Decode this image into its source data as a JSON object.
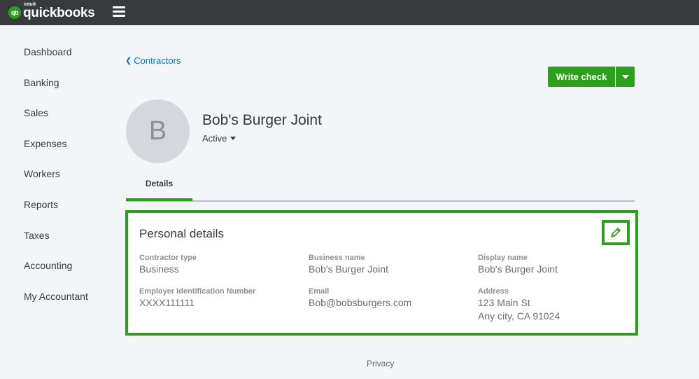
{
  "brand": {
    "intuit": "intuit",
    "name": "quickbooks",
    "mark": "qb"
  },
  "sidebar": {
    "items": [
      {
        "label": "Dashboard"
      },
      {
        "label": "Banking"
      },
      {
        "label": "Sales"
      },
      {
        "label": "Expenses"
      },
      {
        "label": "Workers"
      },
      {
        "label": "Reports"
      },
      {
        "label": "Taxes"
      },
      {
        "label": "Accounting"
      },
      {
        "label": "My Accountant"
      }
    ]
  },
  "breadcrumb": {
    "label": "Contractors"
  },
  "actions": {
    "write_check_label": "Write check"
  },
  "vendor": {
    "initial": "B",
    "name": "Bob's Burger Joint",
    "status": "Active"
  },
  "tabs": [
    {
      "label": "Details"
    }
  ],
  "personal_details": {
    "title": "Personal details",
    "contractor_type_label": "Contractor type",
    "contractor_type_value": "Business",
    "business_name_label": "Business name",
    "business_name_value": "Bob's Burger Joint",
    "display_name_label": "Display name",
    "display_name_value": "Bob's Burger Joint",
    "ein_label": "Employer Identification Number",
    "ein_value": "XXXX111111",
    "email_label": "Email",
    "email_value": "Bob@bobsburgers.com",
    "address_label": "Address",
    "address_line1": "123 Main St",
    "address_line2": "Any city, CA 91024"
  },
  "footer": {
    "privacy_label": "Privacy"
  },
  "icons": {
    "menu": "hamburger-icon",
    "back": "chevron-left-icon",
    "dropdown": "caret-down-icon",
    "edit": "pencil-icon"
  },
  "colors": {
    "brand_green": "#2ca01c",
    "topbar": "#393a3d",
    "link_blue": "#0077c5",
    "background": "#f4f5f8"
  }
}
